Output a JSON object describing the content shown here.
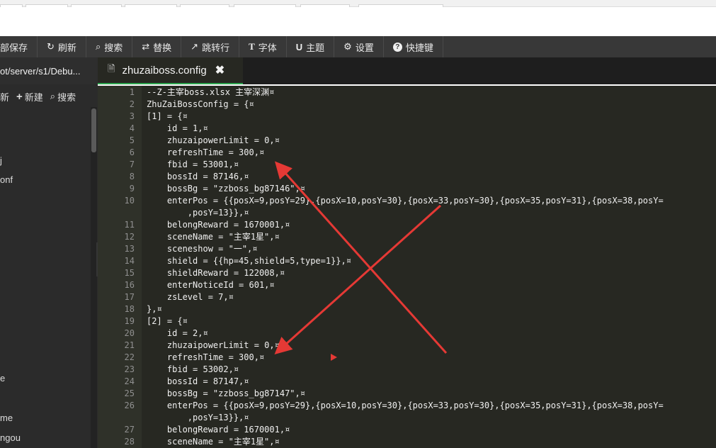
{
  "toolbar": {
    "buttons": [
      {
        "label": "部保存",
        "icon": "save-icon"
      },
      {
        "label": "刷新",
        "icon": "refresh-icon"
      },
      {
        "label": "搜索",
        "icon": "search-icon"
      },
      {
        "label": "替换",
        "icon": "replace-icon"
      },
      {
        "label": "跳转行",
        "icon": "goto-line-icon"
      },
      {
        "label": "字体",
        "icon": "font-icon"
      },
      {
        "label": "主题",
        "icon": "theme-icon"
      },
      {
        "label": "设置",
        "icon": "gear-icon"
      },
      {
        "label": "快捷键",
        "icon": "help-icon"
      }
    ]
  },
  "sidebar": {
    "path": "ot/server/s1/Debu...",
    "actions": {
      "refresh": "新",
      "new": "新建",
      "search": "搜索"
    },
    "tree": [
      "j",
      "onf",
      "e",
      "me",
      "ngou"
    ]
  },
  "editor": {
    "tab_name": "zhuzaiboss.config",
    "lines": [
      {
        "n": "1",
        "text": "--Z-主宰boss.xlsx 主宰深渊¤"
      },
      {
        "n": "2",
        "text": "ZhuZaiBossConfig = {¤"
      },
      {
        "n": "3",
        "text": "[1] = {¤"
      },
      {
        "n": "4",
        "text": "    id = 1,¤"
      },
      {
        "n": "5",
        "text": "    zhuzaipowerLimit = 0,¤"
      },
      {
        "n": "6",
        "text": "    refreshTime = 300,¤"
      },
      {
        "n": "7",
        "text": "    fbid = 53001,¤"
      },
      {
        "n": "8",
        "text": "    bossId = 87146,¤"
      },
      {
        "n": "9",
        "text": "    bossBg = \"zzboss_bg87146\",¤"
      },
      {
        "n": "10",
        "text": "    enterPos = {{posX=9,posY=29},{posX=10,posY=30},{posX=33,posY=30},{posX=35,posY=31},{posX=38,posY="
      },
      {
        "n": "",
        "text": "        ,posY=13}},¤"
      },
      {
        "n": "11",
        "text": "    belongReward = 1670001,¤"
      },
      {
        "n": "12",
        "text": "    sceneName = \"主宰1星\",¤"
      },
      {
        "n": "13",
        "text": "    sceneshow = \"一\",¤"
      },
      {
        "n": "14",
        "text": "    shield = {{hp=45,shield=5,type=1}},¤"
      },
      {
        "n": "15",
        "text": "    shieldReward = 122008,¤"
      },
      {
        "n": "16",
        "text": "    enterNoticeId = 601,¤"
      },
      {
        "n": "17",
        "text": "    zsLevel = 7,¤"
      },
      {
        "n": "18",
        "text": "},¤"
      },
      {
        "n": "19",
        "text": "[2] = {¤"
      },
      {
        "n": "20",
        "text": "    id = 2,¤"
      },
      {
        "n": "21",
        "text": "    zhuzaipowerLimit = 0,¤"
      },
      {
        "n": "22",
        "text": "    refreshTime = 300,¤"
      },
      {
        "n": "23",
        "text": "    fbid = 53002,¤"
      },
      {
        "n": "24",
        "text": "    bossId = 87147,¤"
      },
      {
        "n": "25",
        "text": "    bossBg = \"zzboss_bg87147\",¤"
      },
      {
        "n": "26",
        "text": "    enterPos = {{posX=9,posY=29},{posX=10,posY=30},{posX=33,posY=30},{posX=35,posY=31},{posX=38,posY="
      },
      {
        "n": "",
        "text": "        ,posY=13}},¤"
      },
      {
        "n": "27",
        "text": "    belongReward = 1670001,¤"
      },
      {
        "n": "28",
        "text": "    sceneName = \"主宰1星\",¤"
      }
    ]
  },
  "colors": {
    "annotation": "#e53935",
    "active_tab_border": "#2da44e",
    "editor_bg": "#272822",
    "toolbar_bg": "#383838"
  }
}
